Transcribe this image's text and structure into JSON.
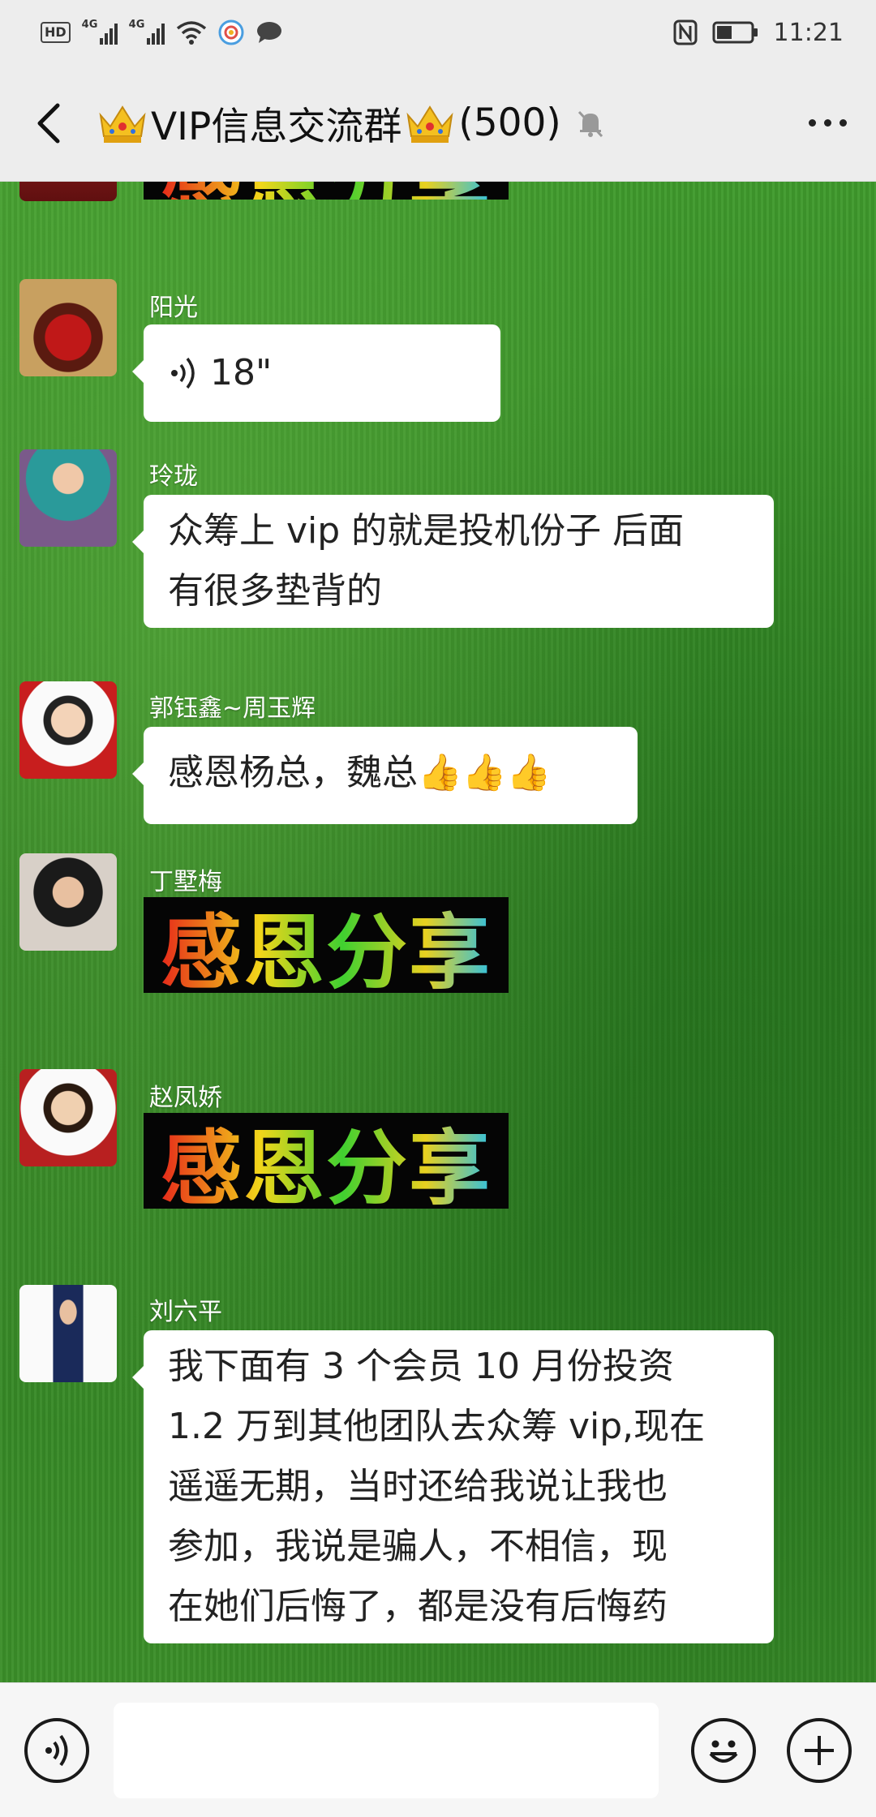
{
  "status_bar": {
    "time": "11:21",
    "network_1": "4G",
    "network_2": "4G",
    "hd": "HD"
  },
  "header": {
    "title": "VIP信息交流群",
    "member_count": "(500)"
  },
  "messages": [
    {
      "sender": "阳光",
      "type": "voice",
      "duration": "18\""
    },
    {
      "sender": "玲珑",
      "type": "text",
      "text": [
        "众筹上 vip 的就是投机份子 后面",
        "有很多垫背的"
      ]
    },
    {
      "sender": "郭钰鑫~周玉辉",
      "type": "text",
      "text": "感恩杨总，魏总👍👍👍"
    },
    {
      "sender": "丁墅梅",
      "type": "sticker",
      "sticker_text": "感恩分享"
    },
    {
      "sender": "赵凤娇",
      "type": "sticker",
      "sticker_text": "感恩分享"
    },
    {
      "sender": "刘六平",
      "type": "text",
      "text": [
        "我下面有 3 个会员 10 月份投资",
        "1.2 万到其他团队去众筹 vip,现在",
        "遥遥无期，当时还给我说让我也",
        "参加，我说是骗人，不相信，现",
        "在她们后悔了，都是没有后悔药"
      ]
    }
  ],
  "top_partial_sticker": {
    "sticker_text": "感恩分享"
  },
  "colors": {
    "bubble": "#ffffff",
    "bar": "#ededed",
    "sticker_bg": "#050505"
  },
  "icons": [
    "back-icon",
    "crown-icon",
    "mute-bell-icon",
    "more-icon",
    "voice-icon",
    "emoji-icon",
    "plus-icon"
  ]
}
